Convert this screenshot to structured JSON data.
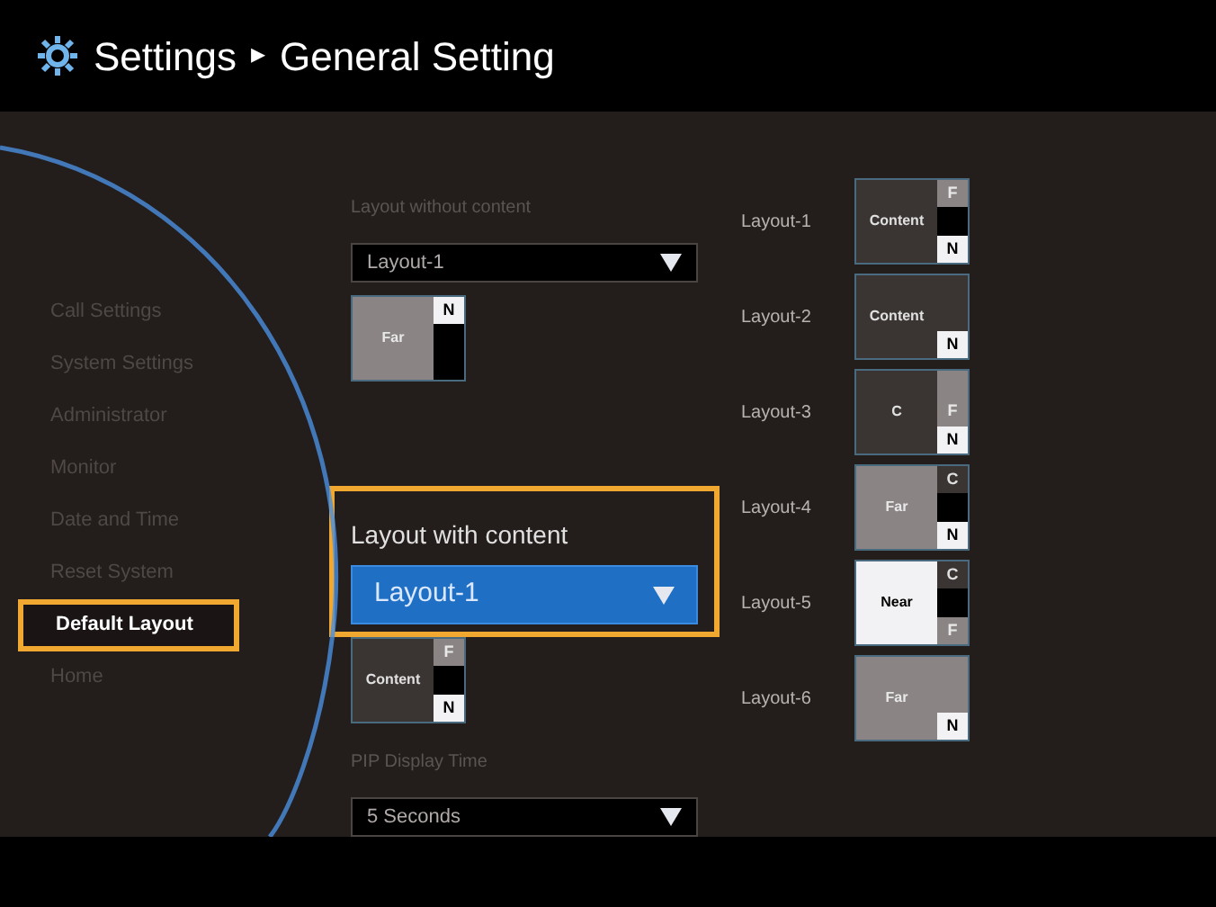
{
  "header": {
    "breadcrumb": "Settings",
    "separator": "▸",
    "title": "General Setting"
  },
  "sidebar": {
    "items": [
      {
        "label": "Call Settings",
        "selected": false
      },
      {
        "label": "System Settings",
        "selected": false
      },
      {
        "label": "Administrator",
        "selected": false
      },
      {
        "label": "Monitor",
        "selected": false
      },
      {
        "label": "Date and Time",
        "selected": false
      },
      {
        "label": "Reset System",
        "selected": false
      },
      {
        "label": "Default Layout",
        "selected": true
      },
      {
        "label": "Home",
        "selected": false
      }
    ]
  },
  "fields": [
    {
      "label": "Layout without content",
      "value": "Layout-1",
      "focused": false,
      "preview": [
        {
          "kind": "gray",
          "text": "Far"
        },
        {
          "kind": "white",
          "text": "N"
        },
        {
          "kind": "black"
        },
        {
          "kind": "black"
        }
      ]
    },
    {
      "label": "Layout with content",
      "value": "Layout-1",
      "focused": true,
      "preview": [
        {
          "kind": "dark",
          "text": "Content"
        },
        {
          "kind": "gray",
          "text": "F"
        },
        {
          "kind": "black"
        },
        {
          "kind": "white",
          "text": "N"
        }
      ]
    },
    {
      "label": "PIP Display Time",
      "value": "5 Seconds",
      "focused": false
    }
  ],
  "layouts": [
    {
      "label": "Layout-1",
      "panes": [
        {
          "kind": "dark",
          "text": "Content"
        },
        {
          "kind": "gray",
          "text": "F"
        },
        {
          "kind": "black"
        },
        {
          "kind": "white",
          "text": "N"
        }
      ]
    },
    {
      "label": "Layout-2",
      "panes": [
        {
          "kind": "dark",
          "text": "Content"
        },
        {
          "kind": "dark"
        },
        {
          "kind": "dark"
        },
        {
          "kind": "white",
          "text": "N"
        }
      ]
    },
    {
      "label": "Layout-3",
      "panes": [
        {
          "kind": "dark",
          "text": "C"
        },
        {
          "kind": "gray"
        },
        {
          "kind": "gray",
          "text": "F"
        },
        {
          "kind": "white",
          "text": "N"
        }
      ]
    },
    {
      "label": "Layout-4",
      "panes": [
        {
          "kind": "gray",
          "text": "Far"
        },
        {
          "kind": "dark",
          "text": "C"
        },
        {
          "kind": "black"
        },
        {
          "kind": "white",
          "text": "N"
        }
      ]
    },
    {
      "label": "Layout-5",
      "panes": [
        {
          "kind": "white",
          "text": "Near"
        },
        {
          "kind": "dark",
          "text": "C"
        },
        {
          "kind": "black"
        },
        {
          "kind": "gray",
          "text": "F"
        }
      ]
    },
    {
      "label": "Layout-6",
      "panes": [
        {
          "kind": "gray",
          "text": "Far"
        },
        {
          "kind": "gray"
        },
        {
          "kind": "gray"
        },
        {
          "kind": "white",
          "text": "N"
        }
      ]
    }
  ]
}
